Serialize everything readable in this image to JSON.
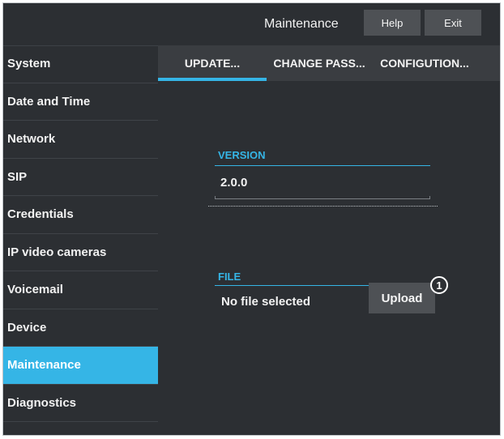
{
  "header": {
    "title": "Maintenance",
    "help_label": "Help",
    "exit_label": "Exit"
  },
  "sidebar": {
    "items": [
      {
        "label": "System"
      },
      {
        "label": "Date and Time"
      },
      {
        "label": "Network"
      },
      {
        "label": "SIP"
      },
      {
        "label": "Credentials"
      },
      {
        "label": "IP video cameras"
      },
      {
        "label": "Voicemail"
      },
      {
        "label": "Device"
      },
      {
        "label": "Maintenance"
      },
      {
        "label": "Diagnostics"
      }
    ],
    "active": "Maintenance"
  },
  "tabs": [
    {
      "label": "UPDATE..."
    },
    {
      "label": "CHANGE PASS..."
    },
    {
      "label": "CONFIGUTION..."
    }
  ],
  "version": {
    "label": "VERSION",
    "value": "2.0.0"
  },
  "file": {
    "label": "FILE",
    "value": "No file selected",
    "upload_label": "Upload"
  },
  "callout": {
    "number": "1"
  },
  "colors": {
    "accent": "#35b5e6",
    "background": "#2c2f33",
    "button": "#4e5155"
  }
}
